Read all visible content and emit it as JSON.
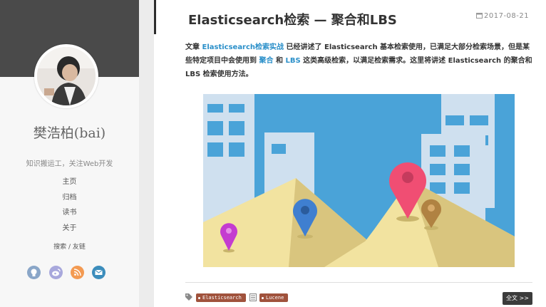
{
  "sidebar": {
    "author_name": "樊浩柏(bai)",
    "tagline": "知识搬运工，关注Web开发",
    "nav": [
      "主页",
      "归档",
      "读书",
      "关于"
    ],
    "search_label": "搜索",
    "separator": " / ",
    "friends_label": "友链",
    "social_icons": [
      {
        "name": "github-icon",
        "color": "#8aa6c8"
      },
      {
        "name": "weibo-icon",
        "color": "#a8a8dc"
      },
      {
        "name": "rss-icon",
        "color": "#f39a52"
      },
      {
        "name": "mail-icon",
        "color": "#3c8dbc"
      }
    ]
  },
  "post": {
    "title": "Elasticsearch检索 — 聚合和LBS",
    "date": "2017-08-21",
    "body": {
      "t1": "文章 ",
      "link1": "Elasticsearch检索实战",
      "t2": " 已经讲述了 Elasticsearch 基本检索使用，已满足大部分检索场景，但是某些特定项目中会使用到 ",
      "link2": "聚合",
      "t3": " 和 ",
      "link3": "LBS",
      "t4": " 这类高级检索，以满足检索需求。这里将讲述 Elasticsearch 的聚合和 LBS 检索使用方法。"
    },
    "tags": [
      "Elasticsearch",
      "Lucene"
    ],
    "read_more": "全文 >>"
  },
  "colors": {
    "sidebar_header": "#4a4a4a",
    "link": "#2a8fc9",
    "tag_bg": "#a0523c",
    "sky": "#4aa3d8"
  }
}
